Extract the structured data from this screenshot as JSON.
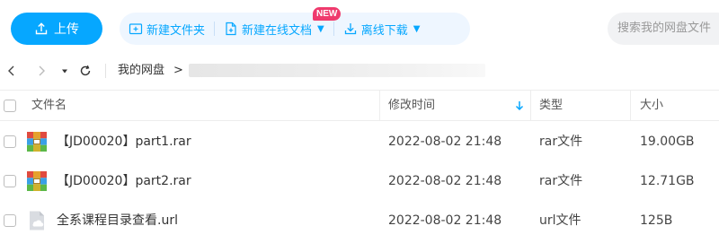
{
  "toolbar": {
    "upload_label": "上传",
    "new_folder_label": "新建文件夹",
    "new_online_doc_label": "新建在线文档",
    "new_badge": "NEW",
    "offline_download_label": "离线下载",
    "search_placeholder": "搜索我的网盘文件",
    "accent_color": "#06a7ff"
  },
  "breadcrumb": {
    "home": "我的网盘",
    "separator": ">"
  },
  "table": {
    "headers": {
      "name": "文件名",
      "modified": "修改时间",
      "type": "类型",
      "size": "大小"
    },
    "sort": {
      "column": "modified",
      "direction": "descending",
      "icon": "arrow-down-icon"
    },
    "rows": [
      {
        "name": "【JD00020】part1.rar",
        "modified": "2022-08-02 21:48",
        "type": "rar文件",
        "size": "19.00GB",
        "icon": "rar-archive-icon"
      },
      {
        "name": "【JD00020】part2.rar",
        "modified": "2022-08-02 21:48",
        "type": "rar文件",
        "size": "12.71GB",
        "icon": "rar-archive-icon"
      },
      {
        "name": "全系课程目录查看.url",
        "modified": "2022-08-02 21:48",
        "type": "url文件",
        "size": "125B",
        "icon": "url-file-icon"
      }
    ]
  }
}
